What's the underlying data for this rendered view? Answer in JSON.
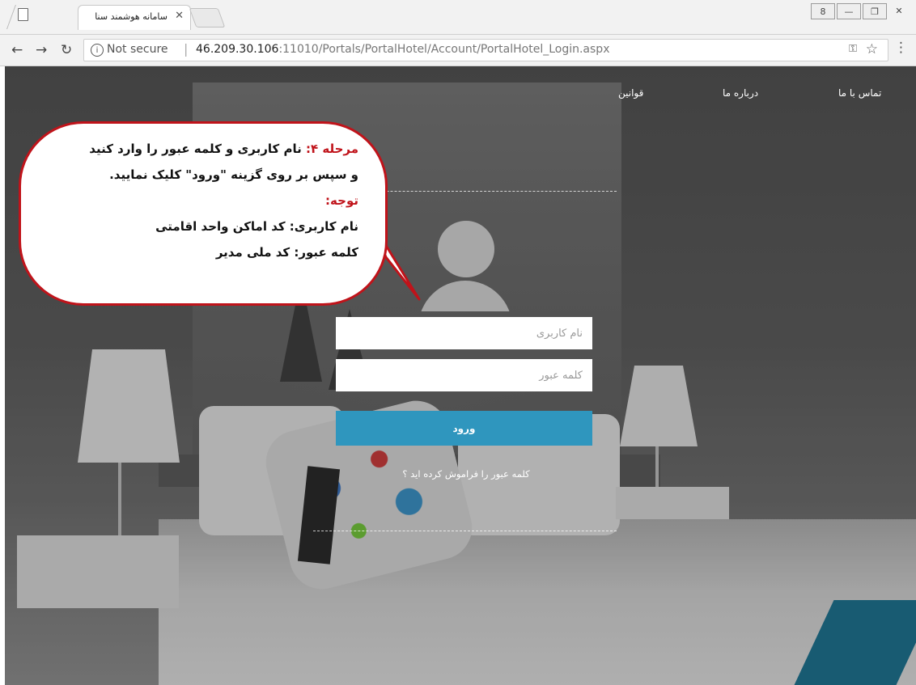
{
  "browser": {
    "tab_title": "سامانه هوشمند سنا",
    "tab_close": "✕",
    "security_label": "Not secure",
    "url_host": "46.209.30.106",
    "url_path": ":11010/Portals/PortalHotel/Account/PortalHotel_Login.aspx",
    "window_controls": [
      "8",
      "—",
      "❐",
      "✕"
    ]
  },
  "nav": {
    "contact": "تماس با ما",
    "about": "درباره ما",
    "rules": "قوانین"
  },
  "login": {
    "username_placeholder": "نام کاربری",
    "password_placeholder": "کلمه عبور",
    "submit_label": "ورود",
    "forgot_link": "کلمه عبور را فراموش کرده اید ؟"
  },
  "callout": {
    "step_label": "مرحله ۴:",
    "line1_rest": " نام کاربری و کلمه عبور را وارد کنید",
    "line2": "و سپس بر روی گزینه \"ورود\" کلیک نمایید.",
    "note_label": "توجه:",
    "username_hint": "نام کاربری: کد اماکن واحد اقامتی",
    "password_hint": "کلمه عبور: کد ملی مدیر"
  },
  "colors": {
    "accent": "#c0131a",
    "button": "#2f96be"
  }
}
